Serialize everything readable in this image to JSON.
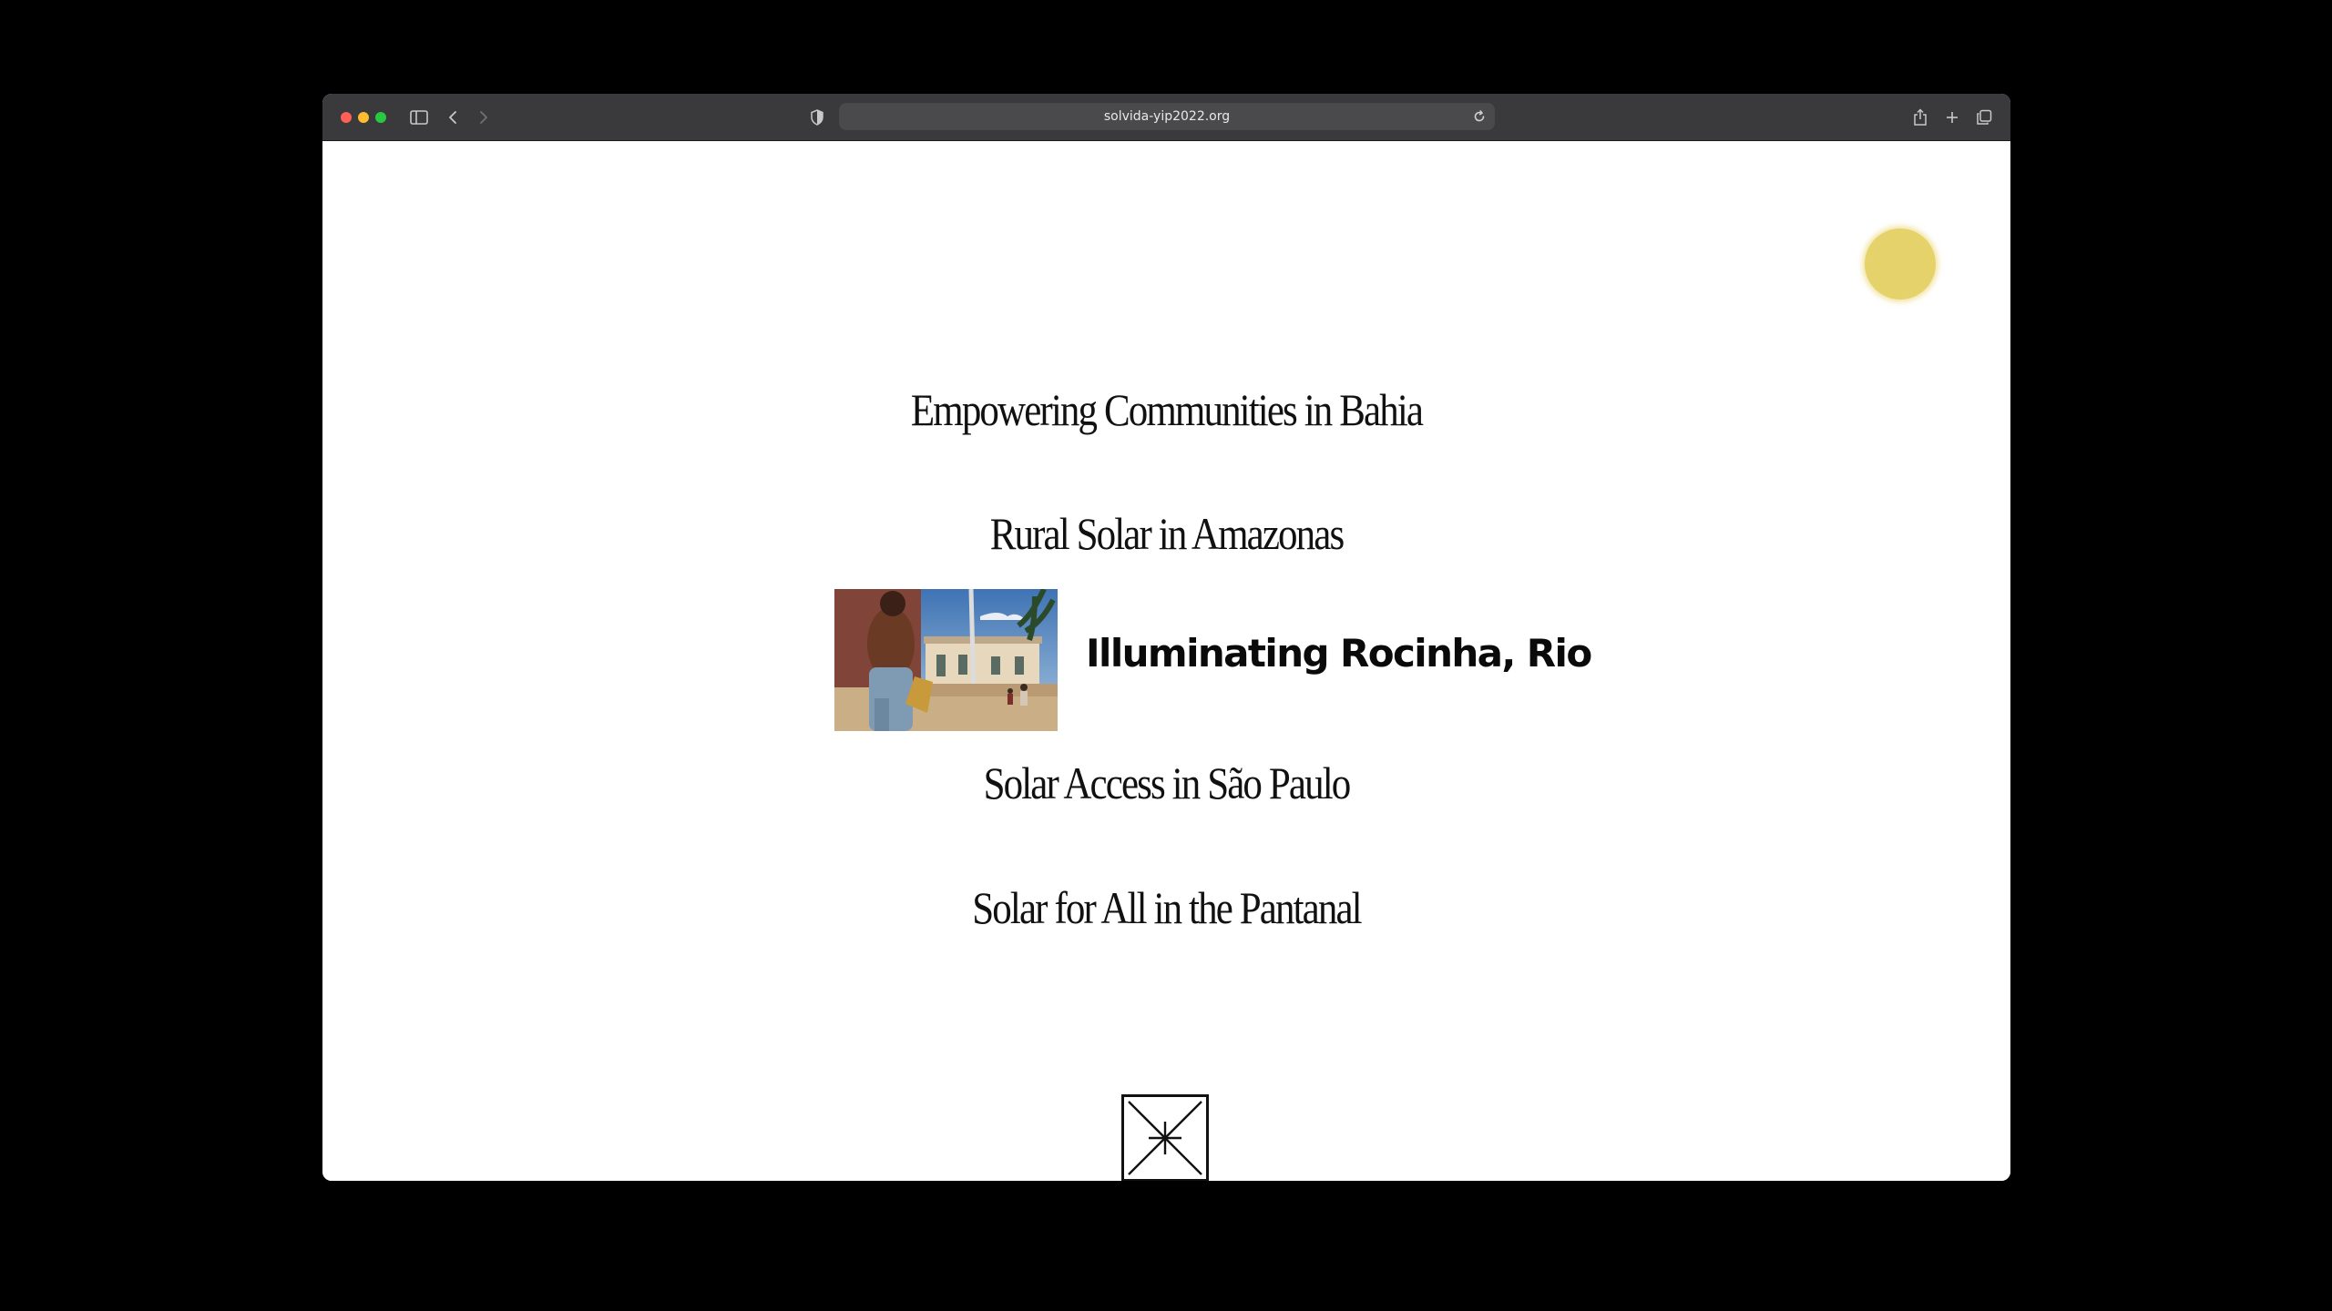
{
  "browser": {
    "url": "solvida-yip2022.org",
    "traffic_lights": {
      "close": "#ff5f57",
      "minimize": "#febc2e",
      "zoom": "#28c840"
    },
    "icons": [
      "sidebar-icon",
      "back-icon",
      "forward-icon",
      "privacy-shield-icon",
      "reload-icon",
      "share-icon",
      "new-tab-icon",
      "tab-overview-icon"
    ]
  },
  "page": {
    "accent_color": "#e6d26a",
    "menu": [
      {
        "label": "Empowering Communities in Bahia"
      },
      {
        "label": "Rural Solar in Amazonas"
      },
      {
        "label": "Illuminating Rocinha, Rio",
        "active": true
      },
      {
        "label": "Solar Access in São Paulo"
      },
      {
        "label": "Solar for All in the Pantanal"
      }
    ],
    "logo_icon": "asterisk-box-icon"
  }
}
